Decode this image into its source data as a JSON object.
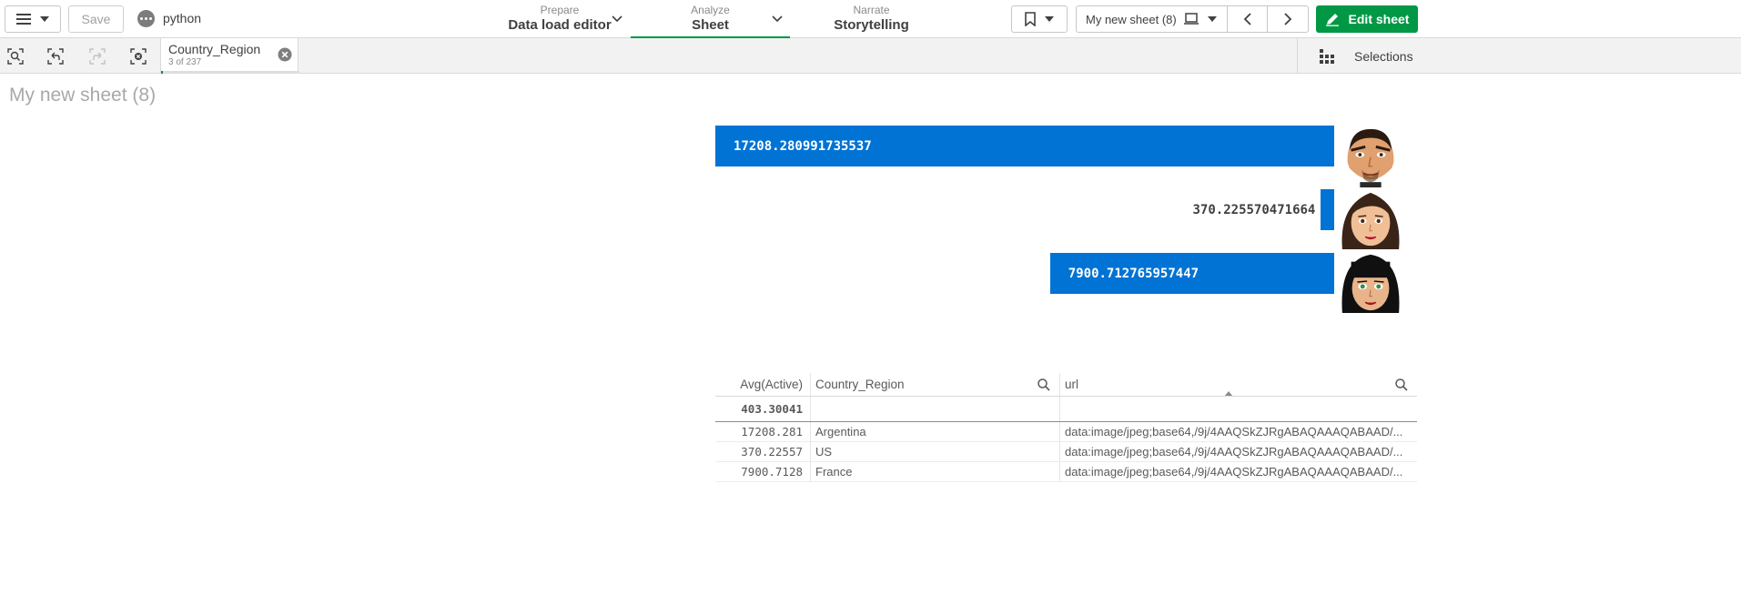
{
  "toolbar": {
    "save_label": "Save",
    "app_name": "python",
    "nav": [
      {
        "small": "Prepare",
        "big": "Data load editor"
      },
      {
        "small": "Analyze",
        "big": "Sheet"
      },
      {
        "small": "Narrate",
        "big": "Storytelling"
      }
    ],
    "sheet_selector": "My new sheet (8)",
    "edit_label": "Edit sheet",
    "accent_color": "#009845"
  },
  "selections_bar": {
    "chip": {
      "field": "Country_Region",
      "count": "3 of 237",
      "selected_fraction": 0.0127
    },
    "selections_label": "Selections"
  },
  "sheet": {
    "title": "My new sheet (8)"
  },
  "chart_data": {
    "type": "bar",
    "orientation": "horizontal",
    "bar_color": "#0073d4",
    "categories": [
      "Argentina",
      "US",
      "France"
    ],
    "values": [
      17208.280991735537,
      370.225570471664,
      7900.712765957447
    ],
    "value_labels": [
      "17208.280991735537",
      "370.225570471664",
      "7900.712765957447"
    ],
    "axis_labels": "hidden",
    "grid": false,
    "category_images": [
      "male-avatar-icon",
      "female-avatar-brown-hair-icon",
      "female-avatar-black-hair-icon"
    ]
  },
  "table": {
    "headers": [
      "Avg(Active)",
      "Country_Region",
      "url"
    ],
    "total": "403.30041",
    "rows": [
      {
        "avg": "17208.281",
        "country": "Argentina",
        "url": "data:image/jpeg;base64,/9j/4AAQSkZJRgABAQAAAQABAAD/..."
      },
      {
        "avg": "370.22557",
        "country": "US",
        "url": "data:image/jpeg;base64,/9j/4AAQSkZJRgABAQAAAQABAAD/..."
      },
      {
        "avg": "7900.7128",
        "country": "France",
        "url": "data:image/jpeg;base64,/9j/4AAQSkZJRgABAQAAAQABAAD/..."
      }
    ]
  }
}
